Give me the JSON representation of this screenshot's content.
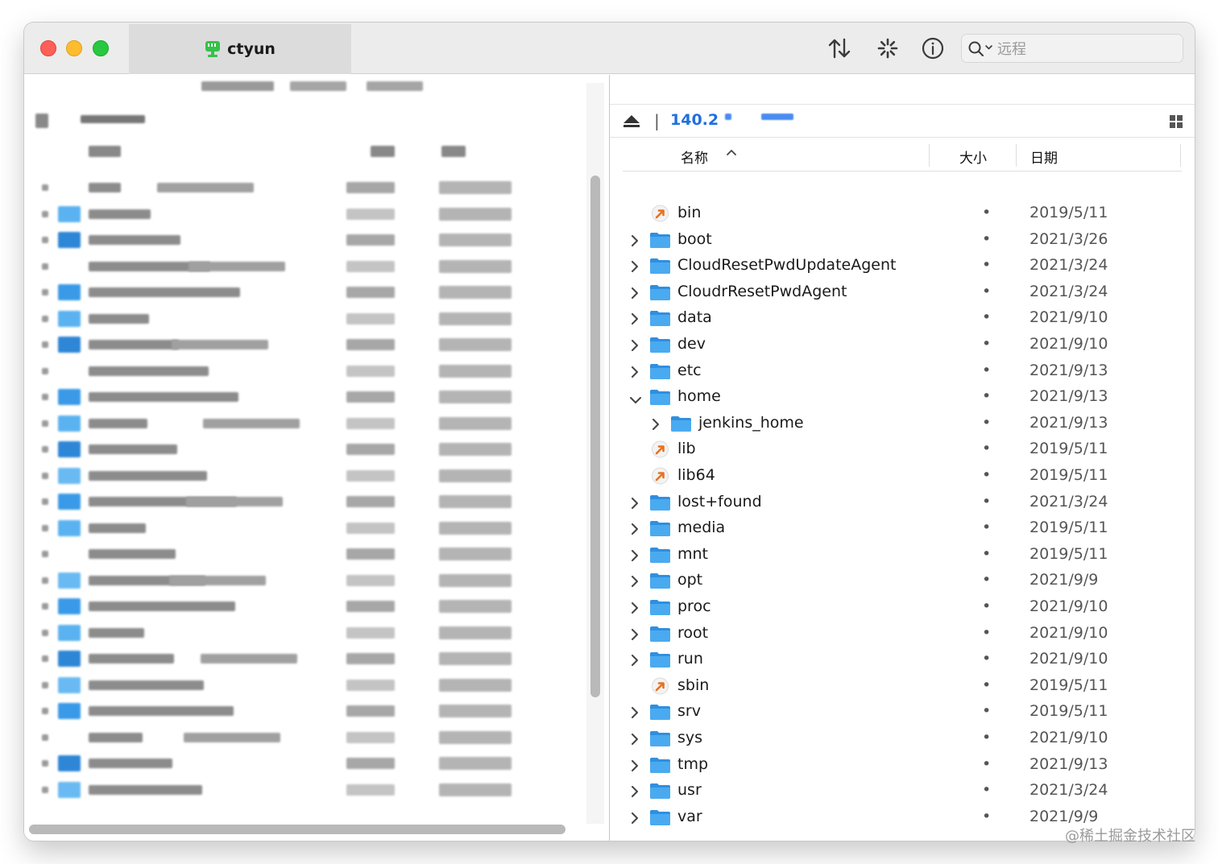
{
  "window": {
    "tab_title": "ctyun",
    "search_placeholder": "远程"
  },
  "remote": {
    "host": "140.2",
    "columns": {
      "name": "名称",
      "size": "大小",
      "date": "日期"
    },
    "files": [
      {
        "name": "bin",
        "type": "symlink",
        "expander": "none",
        "size": "•",
        "date": "2019/5/11",
        "depth": 0
      },
      {
        "name": "boot",
        "type": "folder",
        "expander": "collapsed",
        "size": "•",
        "date": "2021/3/26",
        "depth": 0
      },
      {
        "name": "CloudResetPwdUpdateAgent",
        "type": "folder",
        "expander": "collapsed",
        "size": "•",
        "date": "2021/3/24",
        "depth": 0
      },
      {
        "name": "CloudrResetPwdAgent",
        "type": "folder",
        "expander": "collapsed",
        "size": "•",
        "date": "2021/3/24",
        "depth": 0
      },
      {
        "name": "data",
        "type": "folder",
        "expander": "collapsed",
        "size": "•",
        "date": "2021/9/10",
        "depth": 0
      },
      {
        "name": "dev",
        "type": "folder",
        "expander": "collapsed",
        "size": "•",
        "date": "2021/9/10",
        "depth": 0
      },
      {
        "name": "etc",
        "type": "folder",
        "expander": "collapsed",
        "size": "•",
        "date": "2021/9/13",
        "depth": 0
      },
      {
        "name": "home",
        "type": "folder",
        "expander": "expanded",
        "size": "•",
        "date": "2021/9/13",
        "depth": 0
      },
      {
        "name": "jenkins_home",
        "type": "folder",
        "expander": "collapsed",
        "size": "•",
        "date": "2021/9/13",
        "depth": 1
      },
      {
        "name": "lib",
        "type": "symlink",
        "expander": "none",
        "size": "•",
        "date": "2019/5/11",
        "depth": 0
      },
      {
        "name": "lib64",
        "type": "symlink",
        "expander": "none",
        "size": "•",
        "date": "2019/5/11",
        "depth": 0
      },
      {
        "name": "lost+found",
        "type": "folder",
        "expander": "collapsed",
        "size": "•",
        "date": "2021/3/24",
        "depth": 0
      },
      {
        "name": "media",
        "type": "folder",
        "expander": "collapsed",
        "size": "•",
        "date": "2019/5/11",
        "depth": 0
      },
      {
        "name": "mnt",
        "type": "folder",
        "expander": "collapsed",
        "size": "•",
        "date": "2019/5/11",
        "depth": 0
      },
      {
        "name": "opt",
        "type": "folder",
        "expander": "collapsed",
        "size": "•",
        "date": "2021/9/9",
        "depth": 0
      },
      {
        "name": "proc",
        "type": "folder",
        "expander": "collapsed",
        "size": "•",
        "date": "2021/9/10",
        "depth": 0
      },
      {
        "name": "root",
        "type": "folder",
        "expander": "collapsed",
        "size": "•",
        "date": "2021/9/10",
        "depth": 0
      },
      {
        "name": "run",
        "type": "folder",
        "expander": "collapsed",
        "size": "•",
        "date": "2021/9/10",
        "depth": 0
      },
      {
        "name": "sbin",
        "type": "symlink",
        "expander": "none",
        "size": "•",
        "date": "2019/5/11",
        "depth": 0
      },
      {
        "name": "srv",
        "type": "folder",
        "expander": "collapsed",
        "size": "•",
        "date": "2019/5/11",
        "depth": 0
      },
      {
        "name": "sys",
        "type": "folder",
        "expander": "collapsed",
        "size": "•",
        "date": "2021/9/10",
        "depth": 0
      },
      {
        "name": "tmp",
        "type": "folder",
        "expander": "collapsed",
        "size": "•",
        "date": "2021/9/13",
        "depth": 0
      },
      {
        "name": "usr",
        "type": "folder",
        "expander": "collapsed",
        "size": "•",
        "date": "2021/3/24",
        "depth": 0
      },
      {
        "name": "var",
        "type": "folder",
        "expander": "collapsed",
        "size": "•",
        "date": "2021/9/9",
        "depth": 0
      }
    ]
  },
  "watermark": "@稀土掘金技术社区",
  "colors": {
    "folder_blue": "#3aa0ec",
    "host_blue": "#1f6fe0",
    "symlink_orange": "#e8711f"
  },
  "icons": {
    "sort": "arrows-up-down-icon",
    "activity": "spinner-icon",
    "info": "info-icon",
    "search": "magnifier-icon",
    "eject": "eject-icon",
    "view": "grid-view-icon"
  }
}
